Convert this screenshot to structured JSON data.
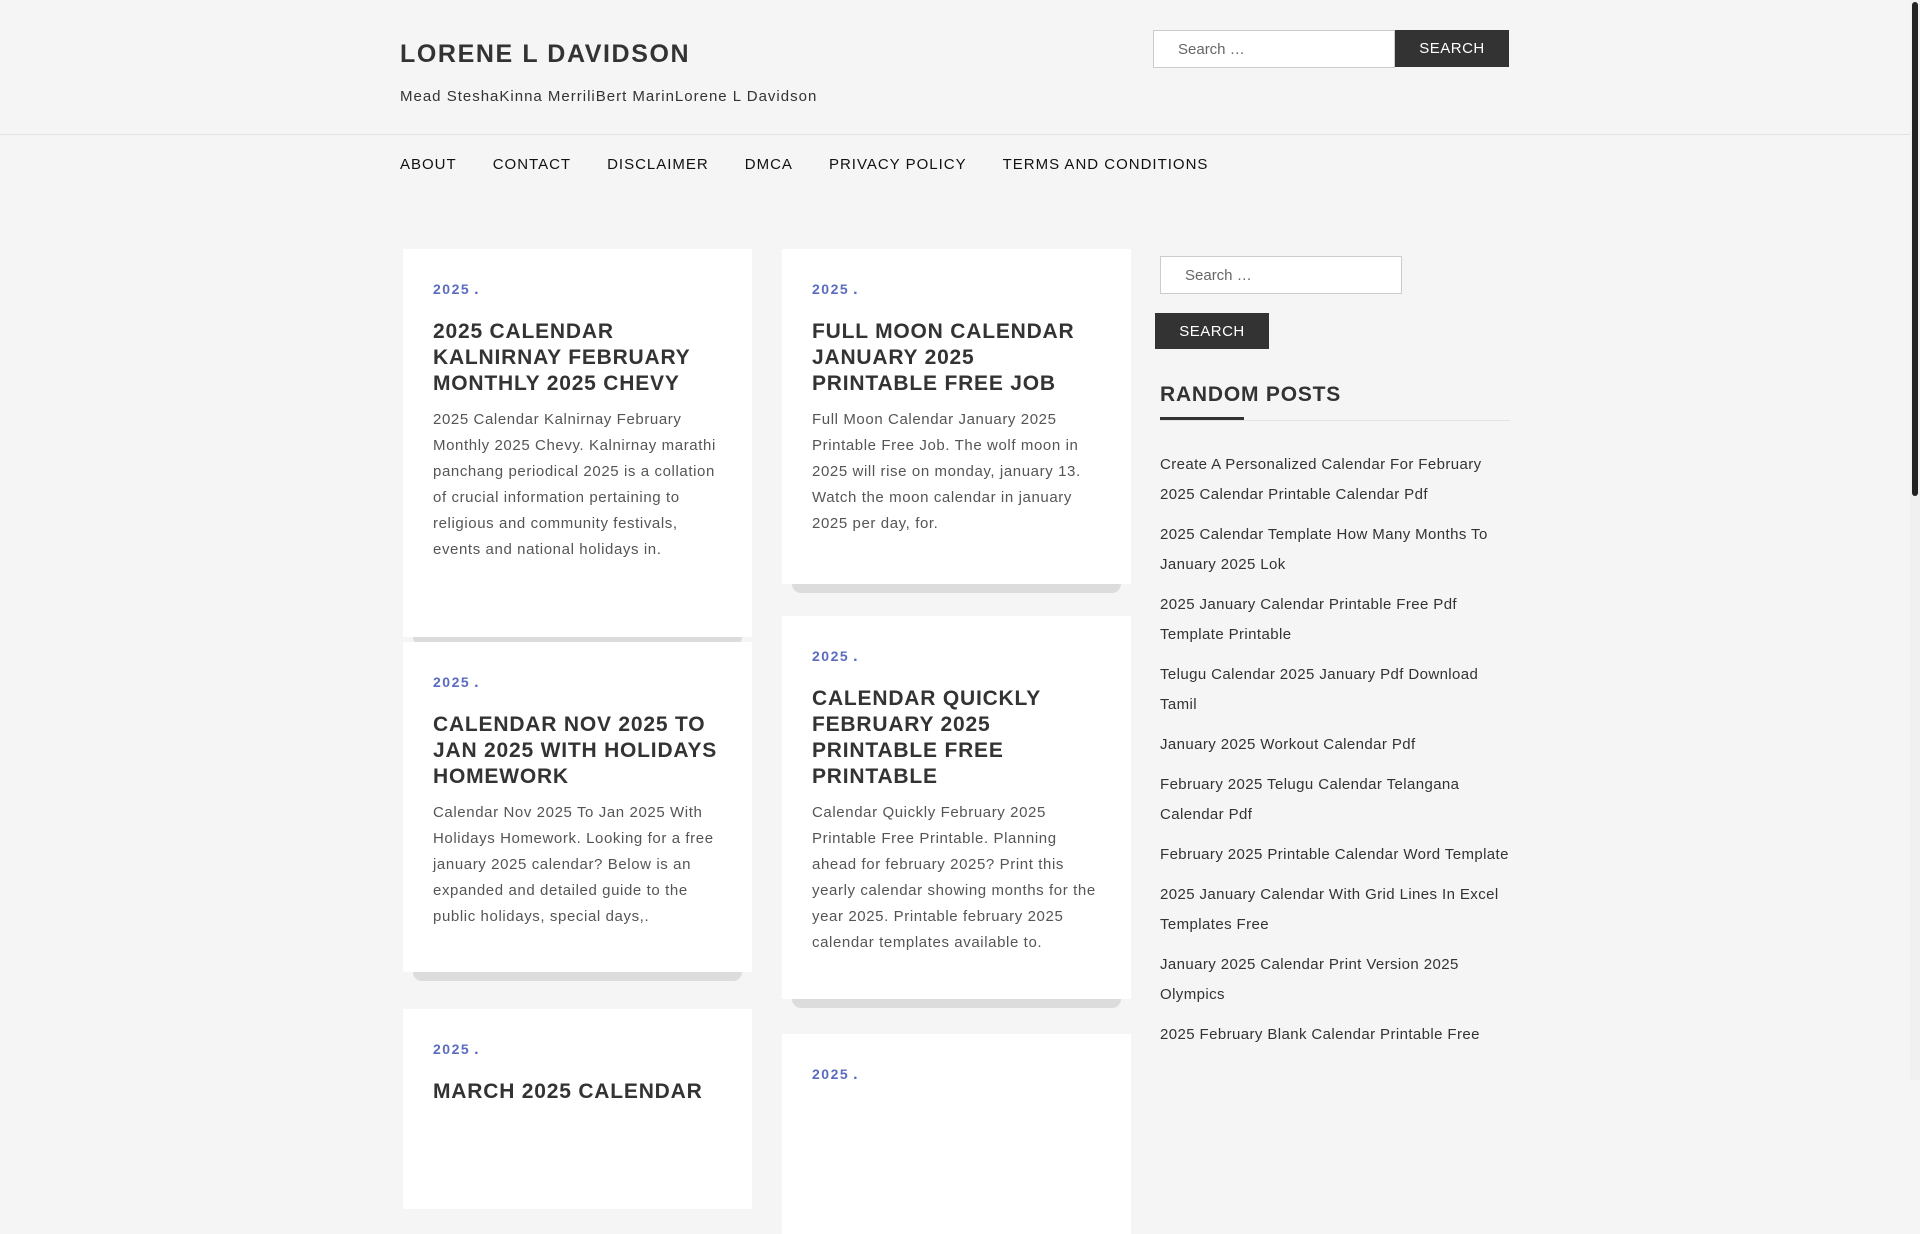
{
  "site": {
    "title": "LORENE L DAVIDSON",
    "description": "Mead SteshaKinna MerriliBert MarinLorene L Davidson"
  },
  "search": {
    "placeholder": "Search …",
    "button": "Search"
  },
  "nav": {
    "items": [
      "About",
      "Contact",
      "Disclaimer",
      "DMCA",
      "Privacy Policy",
      "Terms and Conditions"
    ]
  },
  "posts": [
    {
      "category": "2025",
      "title": "2025 Calendar Kalnirnay February Monthly 2025 Chevy",
      "excerpt": "2025 Calendar Kalnirnay February Monthly 2025 Chevy. Kalnirnay marathi panchang periodical 2025 is a collation of crucial information pertaining to religious and community festivals, events and national holidays in."
    },
    {
      "category": "2025",
      "title": "Full Moon Calendar January 2025 Printable Free Job",
      "excerpt": "Full Moon Calendar January 2025 Printable Free Job. The wolf moon in 2025 will rise on monday, january 13. Watch the moon calendar in january 2025 per day, for."
    },
    {
      "category": "2025",
      "title": "Calendar Nov 2025 To Jan 2025 With Holidays Homework",
      "excerpt": "Calendar Nov 2025 To Jan 2025 With Holidays Homework. Looking for a free january 2025 calendar? Below is an expanded and detailed guide to the public holidays, special days,."
    },
    {
      "category": "2025",
      "title": "Calendar Quickly February 2025 Printable Free Printable",
      "excerpt": "Calendar Quickly February 2025 Printable Free Printable. Planning ahead for february 2025? Print this yearly calendar showing months for the year 2025. Printable february 2025 calendar templates available to."
    },
    {
      "category": "2025",
      "title": "March 2025 Calendar",
      "excerpt": ""
    },
    {
      "category": "2025",
      "title": "",
      "excerpt": ""
    }
  ],
  "sidebar": {
    "random_posts_title": "Random Posts",
    "random_posts": [
      "Create A Personalized Calendar For February 2025 Calendar Printable Calendar Pdf",
      "2025 Calendar Template How Many Months To January 2025 Lok",
      "2025 January Calendar Printable Free Pdf Template Printable",
      "Telugu Calendar 2025 January Pdf Download Tamil",
      "January 2025 Workout Calendar Pdf",
      "February 2025 Telugu Calendar Telangana Calendar Pdf",
      "February 2025 Printable Calendar Word Template",
      "2025 January Calendar With Grid Lines In Excel Templates Free",
      "January 2025 Calendar Print Version 2025 Olympics",
      "2025 February Blank Calendar Printable Free"
    ]
  }
}
